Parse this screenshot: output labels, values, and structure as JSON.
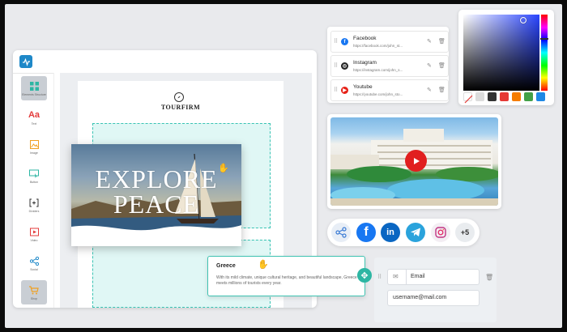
{
  "editor": {
    "brand": "TOURFIRM",
    "sidebar": [
      {
        "label": "Elements\nStructure",
        "icon": "grid-icon",
        "color": "#2db6a3"
      },
      {
        "label": "Text",
        "icon": "text-icon",
        "glyph": "Aa",
        "color": "#e33b3b"
      },
      {
        "label": "Image",
        "icon": "image-icon",
        "color": "#f0a020"
      },
      {
        "label": "Button",
        "icon": "button-icon",
        "color": "#2db6a3"
      },
      {
        "label": "Dividers",
        "icon": "divider-icon",
        "color": "#333333"
      },
      {
        "label": "Video",
        "icon": "video-icon",
        "color": "#e33b3b"
      },
      {
        "label": "Social",
        "icon": "share-icon",
        "color": "#1e88c8"
      },
      {
        "label": "Shop",
        "icon": "cart-icon",
        "color": "#f0a020"
      }
    ],
    "hero": {
      "line1": "EXPLORE",
      "line2": "PEACE"
    }
  },
  "greece_card": {
    "title": "Greece",
    "body": "With its mild climate, unique cultural heritage, and beautiful landscape, Greece meets millions of tourists every year."
  },
  "social_links": [
    {
      "name": "Facebook",
      "url": "https://facebook.com/john_st...",
      "color": "#1877f2",
      "icon": "facebook-icon"
    },
    {
      "name": "Instagram",
      "url": "https://instagram.com/john_s...",
      "color": "#222222",
      "icon": "instagram-icon"
    },
    {
      "name": "Youtube",
      "url": "https://youtube.com/john_sto...",
      "color": "#e62117",
      "icon": "youtube-icon"
    }
  ],
  "color_picker": {
    "swatches": [
      "#ffffff",
      "#dcdcdc",
      "#333333",
      "#e53935",
      "#f57c00",
      "#43a047",
      "#1e88e5"
    ]
  },
  "share_bar": {
    "more_label": "+5",
    "buttons": [
      {
        "icon": "share-icon",
        "color": "#e8eef6"
      },
      {
        "icon": "facebook-icon",
        "color": "#1877f2"
      },
      {
        "icon": "linkedin-icon",
        "color": "#0a66c2"
      },
      {
        "icon": "telegram-icon",
        "color": "#2aa3dc"
      },
      {
        "icon": "instagram-icon",
        "color": "#f3eef3"
      }
    ]
  },
  "email_form": {
    "label": "Email",
    "value": "username@mail.com"
  }
}
